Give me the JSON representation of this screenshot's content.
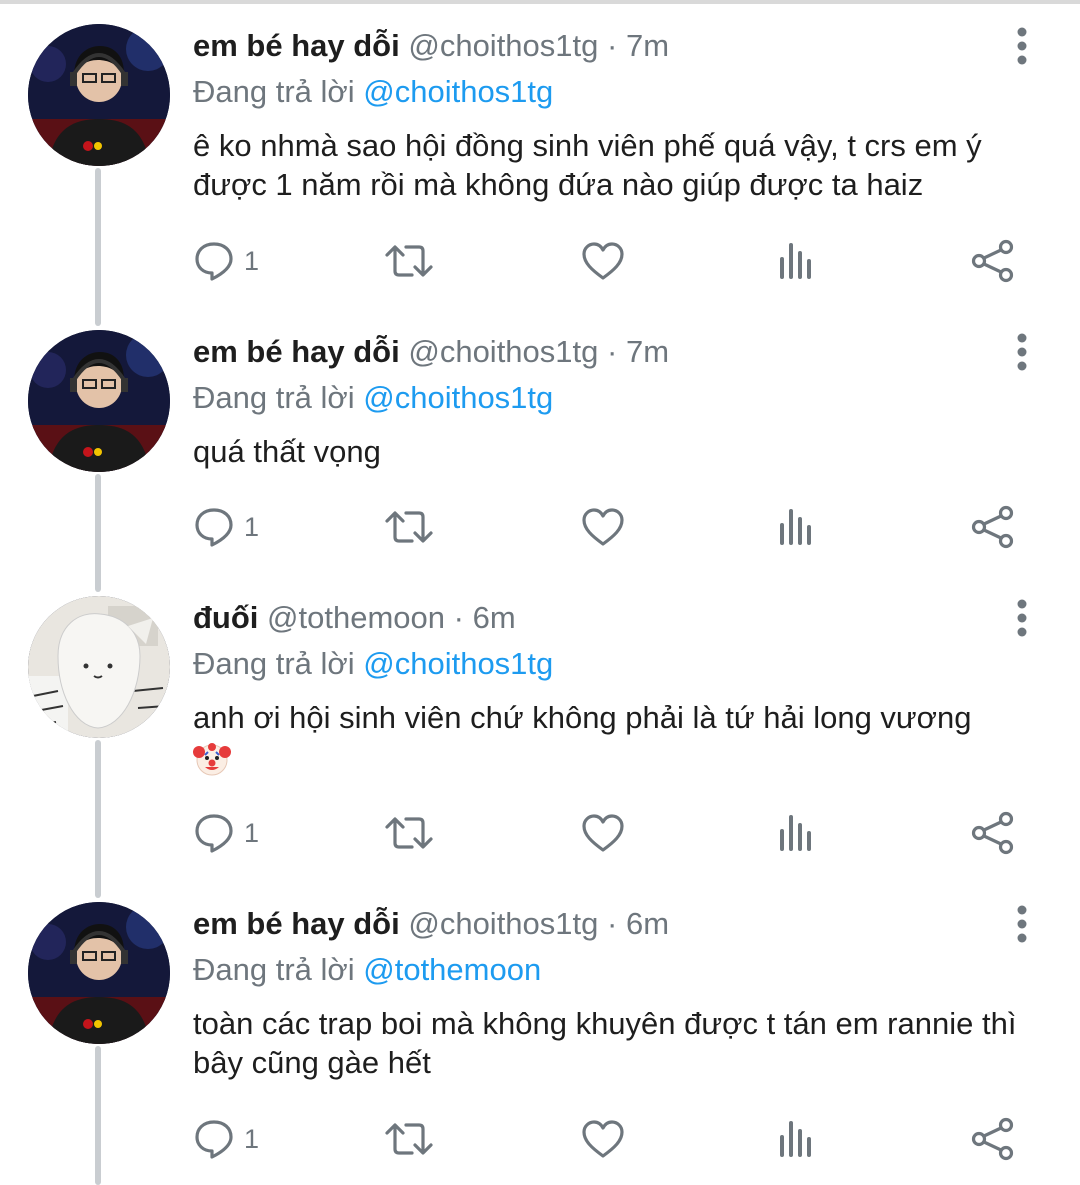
{
  "tweets": [
    {
      "name": "em bé hay dỗi",
      "handle": "@choithos1tg",
      "time": "7m",
      "reply_prefix": "Đang trả lời",
      "reply_to": "@choithos1tg",
      "text": "ê ko nhmà sao hội đồng sinh viên phế quá vậy, t crs em ý được 1 năm rồi mà không đứa nào giúp được ta haiz",
      "reply_count": "1"
    },
    {
      "name": "em bé hay dỗi",
      "handle": "@choithos1tg",
      "time": "7m",
      "reply_prefix": "Đang trả lời",
      "reply_to": "@choithos1tg",
      "text": "quá thất vọng",
      "reply_count": "1"
    },
    {
      "name": "đuối",
      "handle": "@tothemoon",
      "time": "6m",
      "reply_prefix": "Đang trả lời",
      "reply_to": "@choithos1tg",
      "text": "anh ơi hội sinh viên chứ không phải là tứ hải long vương",
      "reply_count": "1"
    },
    {
      "name": "em bé hay dỗi",
      "handle": "@choithos1tg",
      "time": "6m",
      "reply_prefix": "Đang trả lời",
      "reply_to": "@tothemoon",
      "text": "toàn các trap boi mà không khuyên được t tán em rannie thì bây cũng gàe hết",
      "reply_count": "1"
    }
  ],
  "separator": "·",
  "colors": {
    "text_primary": "#1e1e1e",
    "text_secondary": "#6e767d",
    "link": "#1d9bf0",
    "icon": "#6e767d",
    "thread_line": "#c9cdd1"
  },
  "icons": [
    "more-vertical-icon",
    "reply-icon",
    "retweet-icon",
    "like-icon",
    "analytics-icon",
    "share-icon",
    "clown-emoji"
  ]
}
